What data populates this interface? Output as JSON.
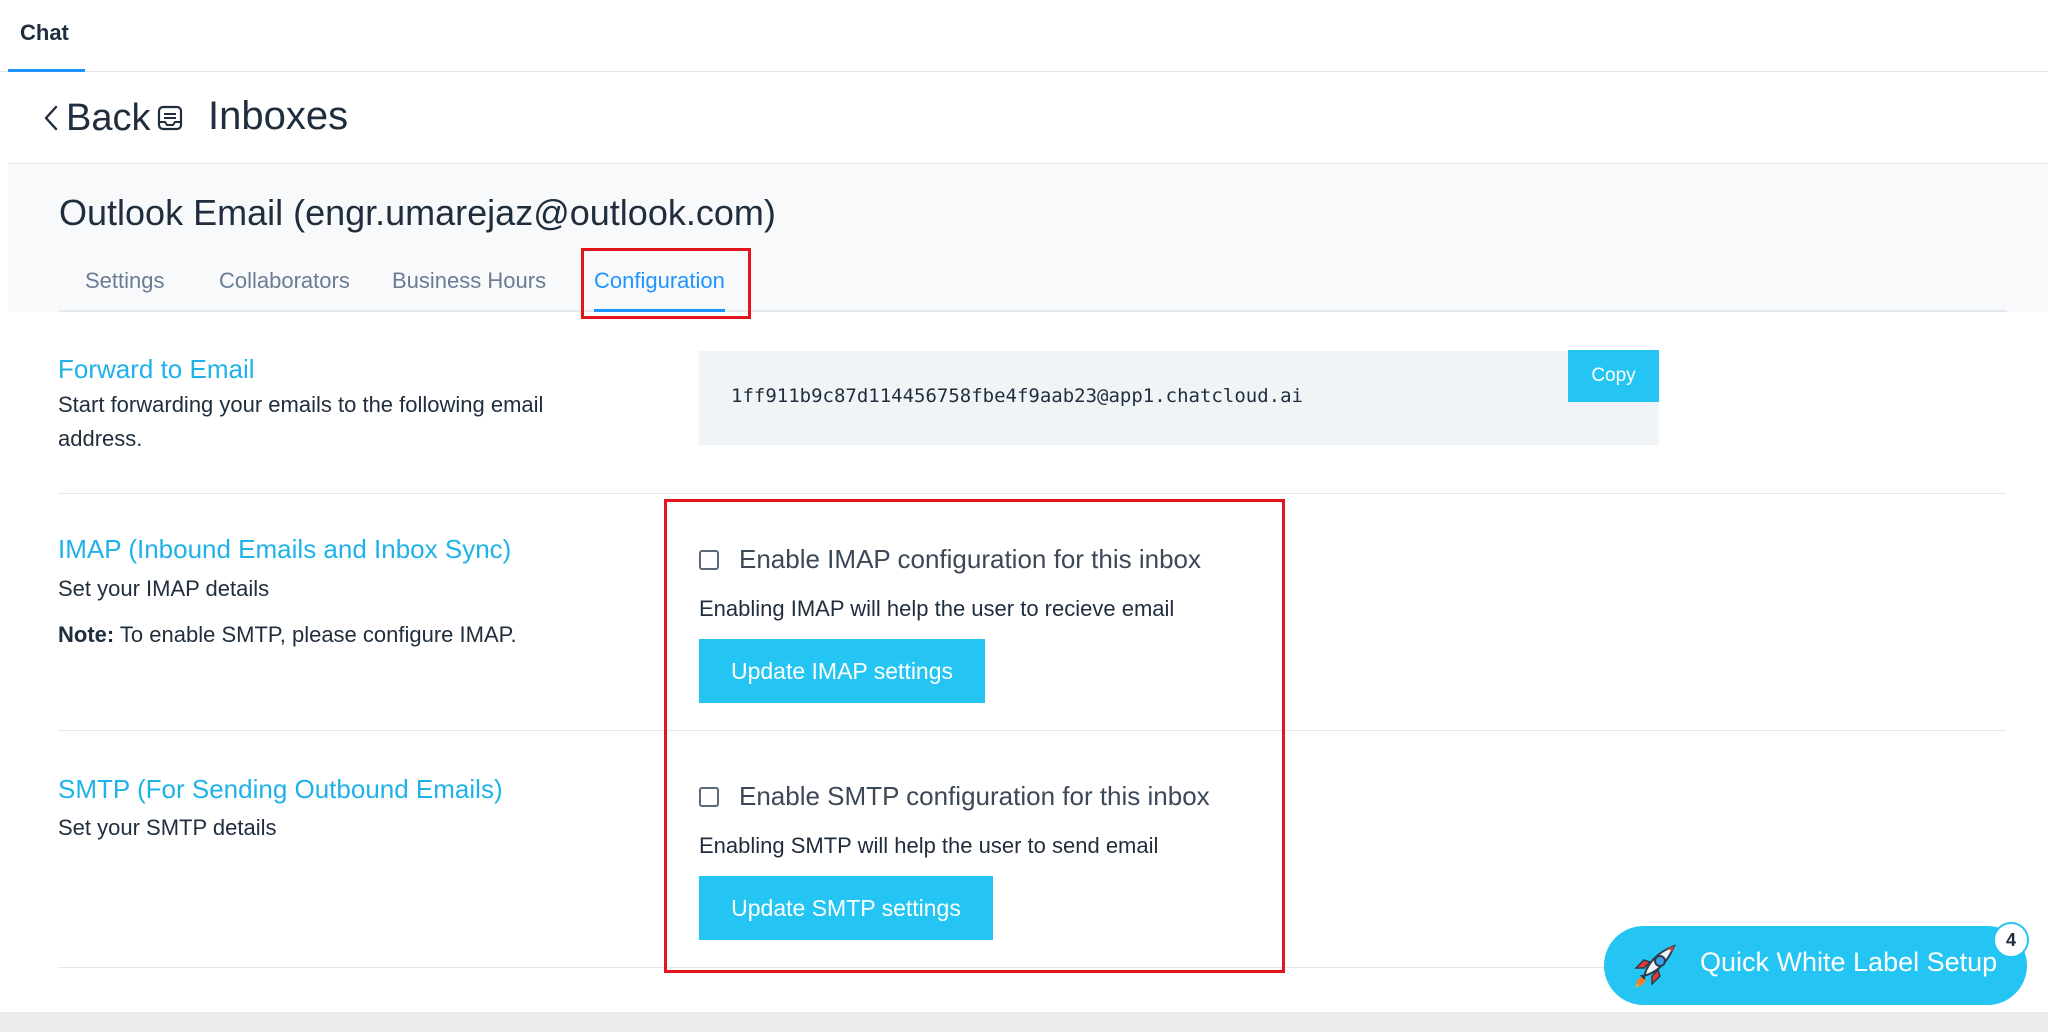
{
  "topbar": {
    "tab_label": "Chat"
  },
  "header": {
    "back_label": "Back",
    "title": "Inboxes"
  },
  "inbox": {
    "name": "Outlook Email (engr.umarejaz@outlook.com)",
    "tabs": [
      {
        "label": "Settings"
      },
      {
        "label": "Collaborators"
      },
      {
        "label": "Business Hours"
      },
      {
        "label": "Configuration",
        "active": true
      }
    ]
  },
  "forward": {
    "title": "Forward to Email",
    "desc": "Start forwarding your emails to the following email address.",
    "email": "1ff911b9c87d114456758fbe4f9aab23@app1.chatcloud.ai",
    "copy_label": "Copy"
  },
  "imap": {
    "title": "IMAP (Inbound Emails and Inbox Sync)",
    "desc": "Set your IMAP details",
    "note_bold": "Note:",
    "note_text": " To enable SMTP, please configure IMAP.",
    "checkbox_label": "Enable IMAP configuration for this inbox",
    "checked": false,
    "help": "Enabling IMAP will help the user to recieve email",
    "button_label": "Update IMAP settings"
  },
  "smtp": {
    "title": "SMTP (For Sending Outbound Emails)",
    "desc": "Set your SMTP details",
    "checkbox_label": "Enable SMTP configuration for this inbox",
    "checked": false,
    "help": "Enabling SMTP will help the user to send email",
    "button_label": "Update SMTP settings"
  },
  "fab": {
    "label": "Quick White Label Setup",
    "badge": "4",
    "icon": "rocket-icon"
  },
  "colors": {
    "accent": "#24c5f2",
    "link": "#1fb2e8",
    "highlight": "#e3141b",
    "tab_active": "#1f93ff"
  }
}
